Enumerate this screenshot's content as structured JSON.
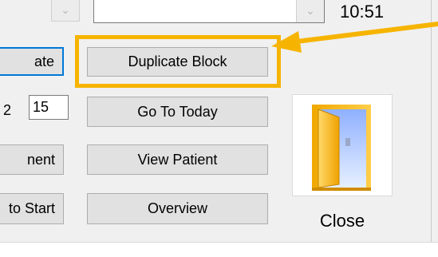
{
  "header": {
    "time": "10:51"
  },
  "buttons": {
    "update_partial": "ate",
    "duplicate_block": "Duplicate Block",
    "go_to_today": "Go To Today",
    "appointment_partial": "nent",
    "view_patient": "View Patient",
    "back_to_start_partial": "to Start",
    "overview": "Overview",
    "close": "Close"
  },
  "inputs": {
    "left_value_partial": "2",
    "interval": "15"
  },
  "icons": {
    "combo_arrow": "chevron-down-icon",
    "close": "door-icon"
  },
  "colors": {
    "highlight": "#f6b400",
    "focus_border": "#0078d7",
    "button_face": "#e1e1e1"
  }
}
